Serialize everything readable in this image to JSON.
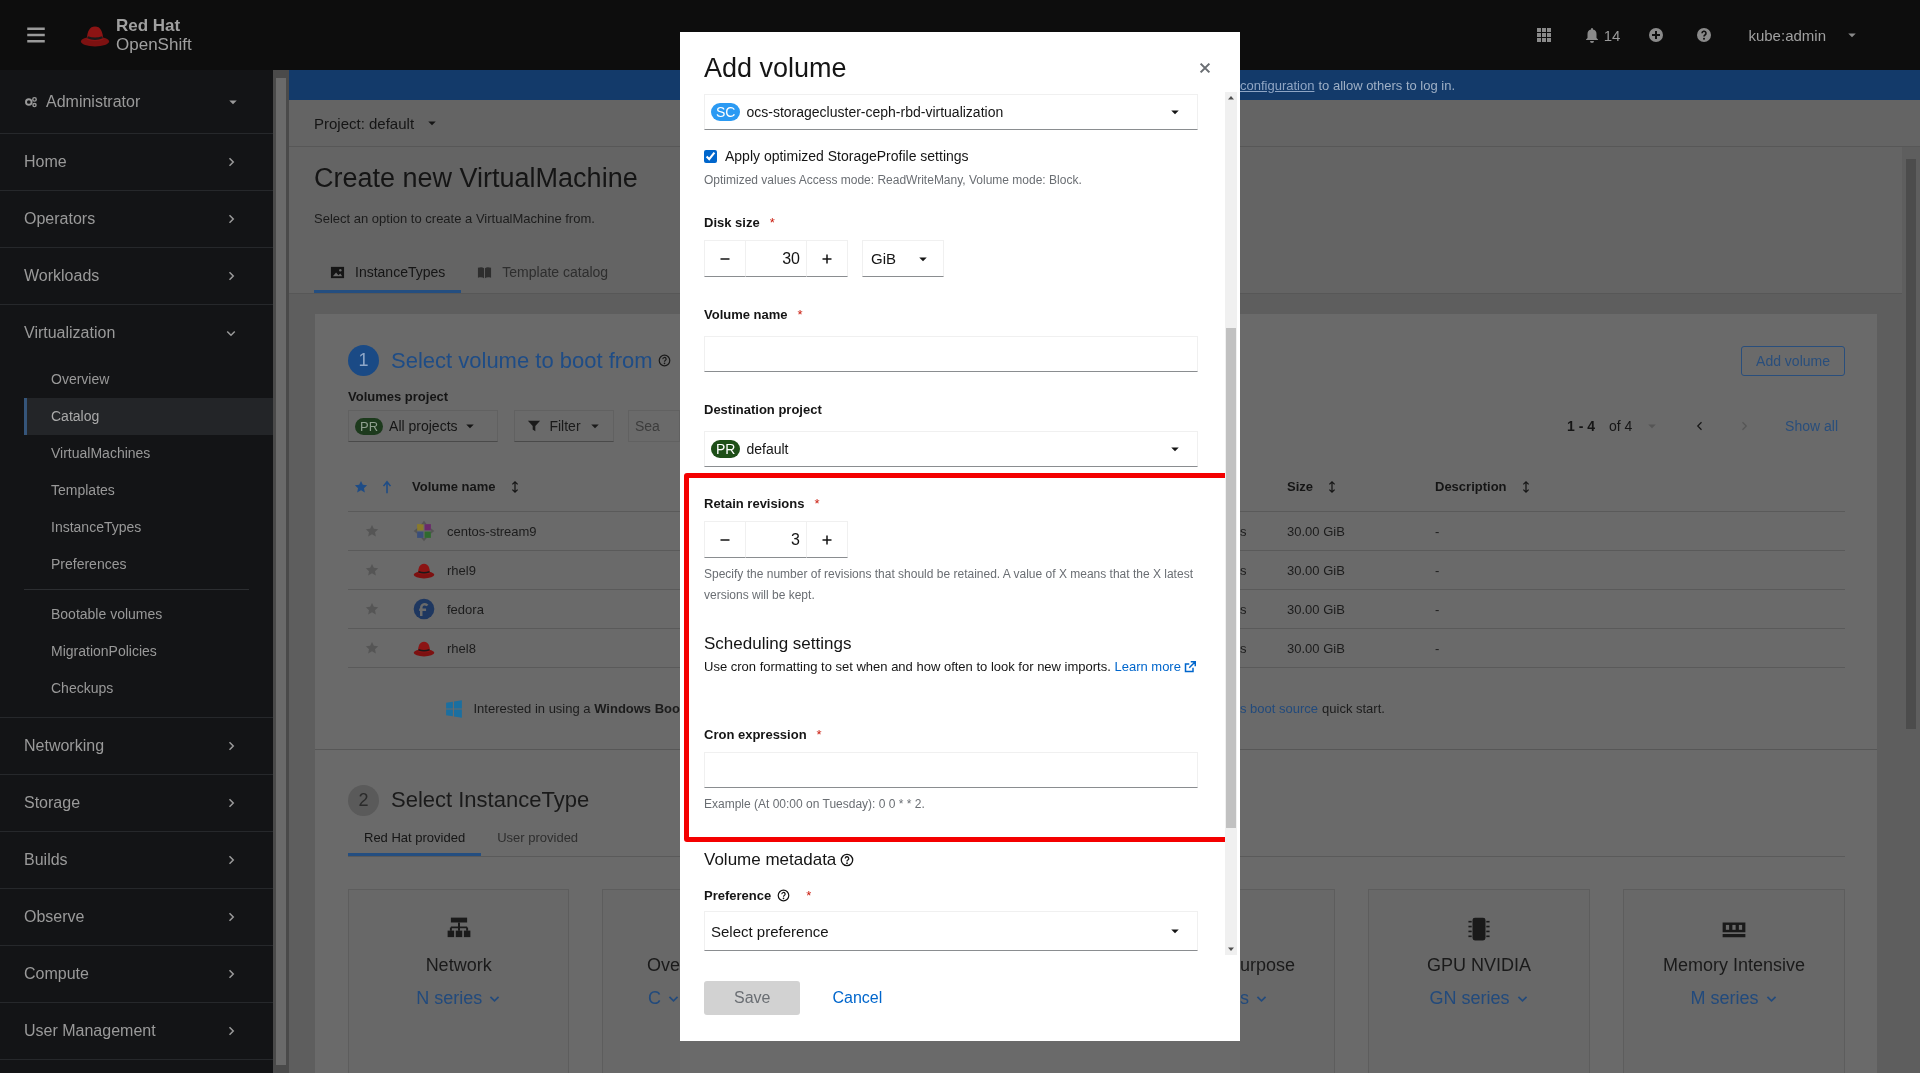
{
  "masthead": {
    "brand_top": "Red Hat",
    "brand_bottom": "OpenShift",
    "notification_count": "14",
    "user": "kube:admin"
  },
  "banner": {
    "link": "configuration",
    "text": "to allow others to log in."
  },
  "sidebar": {
    "perspective": "Administrator",
    "items": [
      {
        "label": "Home",
        "expanded": false
      },
      {
        "label": "Operators",
        "expanded": false
      },
      {
        "label": "Workloads",
        "expanded": false
      },
      {
        "label": "Virtualization",
        "expanded": true,
        "groups": [
          {
            "children": [
              {
                "label": "Overview",
                "selected": false
              },
              {
                "label": "Catalog",
                "selected": true
              },
              {
                "label": "VirtualMachines",
                "selected": false
              },
              {
                "label": "Templates",
                "selected": false
              },
              {
                "label": "InstanceTypes",
                "selected": false
              },
              {
                "label": "Preferences",
                "selected": false
              }
            ]
          },
          {
            "children": [
              {
                "label": "Bootable volumes",
                "selected": false
              },
              {
                "label": "MigrationPolicies",
                "selected": false
              },
              {
                "label": "Checkups",
                "selected": false
              }
            ]
          }
        ]
      },
      {
        "label": "Networking",
        "expanded": false
      },
      {
        "label": "Storage",
        "expanded": false
      },
      {
        "label": "Builds",
        "expanded": false
      },
      {
        "label": "Observe",
        "expanded": false
      },
      {
        "label": "Compute",
        "expanded": false
      },
      {
        "label": "User Management",
        "expanded": false
      }
    ]
  },
  "page": {
    "project_selector": "Project: default",
    "title": "Create new VirtualMachine",
    "subtitle": "Select an option to create a VirtualMachine from.",
    "tabs": [
      {
        "label": "InstanceTypes",
        "selected": true
      },
      {
        "label": "Template catalog",
        "selected": false
      }
    ]
  },
  "volume_step": {
    "number": "1",
    "title": "Select volume to boot from",
    "add_button": "Add volume",
    "project_label": "Volumes project",
    "project_filter": {
      "badge": "PR",
      "value": "All projects"
    },
    "filter_button": "Filter",
    "search_placeholder": "Sea",
    "pagination": "**1 - 4** of 4",
    "show_all": "Show all",
    "table": {
      "columns": [
        {
          "label": "Volume name"
        },
        {
          "label": "Size"
        },
        {
          "label": "Description"
        }
      ],
      "rows": [
        {
          "name": "centos-stream9",
          "column_3": "s",
          "size": "30.00 GiB",
          "description": "-"
        },
        {
          "name": "rhel9",
          "column_3": "s",
          "size": "30.00 GiB",
          "description": "-"
        },
        {
          "name": "fedora",
          "column_3": "s",
          "size": "30.00 GiB",
          "description": "-"
        },
        {
          "name": "rhel8",
          "column_3": "s",
          "size": "30.00 GiB",
          "description": "-"
        }
      ]
    },
    "windows_note": {
      "text": "Interested in using a **Windows Boo**",
      "link": "s boot source",
      "text_end": "quick start."
    }
  },
  "instancetype_step": {
    "number": "2",
    "title": "Select InstanceType",
    "tabs": [
      {
        "label": "Red Hat provided",
        "selected": true
      },
      {
        "label": "User provided",
        "selected": false
      }
    ],
    "tiles": [
      {
        "name": "Network",
        "series": "N series"
      },
      {
        "name": "Ove",
        "series": "C"
      },
      {
        "name": "urpose",
        "series": "s"
      },
      {
        "name": "GPU NVIDIA",
        "series": "GN series"
      },
      {
        "name": "Memory Intensive",
        "series": "M series"
      }
    ]
  },
  "modal": {
    "title": "Add volume",
    "storage_class": {
      "badge": "SC",
      "value": "ocs-storagecluster-ceph-rbd-virtualization"
    },
    "optimize": {
      "label": "Apply optimized StorageProfile settings",
      "checked": true,
      "help": "Optimized values Access mode: ReadWriteMany, Volume mode: Block."
    },
    "disk_size": {
      "label": "Disk size",
      "required_mark": "*",
      "value": "30",
      "unit": "GiB"
    },
    "volume_name": {
      "label": "Volume name",
      "required_mark": "*"
    },
    "destination_project": {
      "label": "Destination project",
      "badge": "PR",
      "value": "default"
    },
    "retain_revisions": {
      "label": "Retain revisions",
      "required_mark": "*",
      "value": "3",
      "help": "Specify the number of revisions that should be retained. A value of X means that the X latest versions will be kept."
    },
    "scheduling": {
      "heading": "Scheduling settings",
      "text": "Use cron formatting to set when and how often to look for new imports.",
      "link": "Learn more"
    },
    "cron_expression": {
      "label": "Cron expression",
      "required_mark": "*",
      "help": "Example (At 00:00 on Tuesday): 0 0 * * 2."
    },
    "volume_metadata": "Volume metadata",
    "preference": {
      "label": "Preference",
      "required_mark": "*",
      "placeholder": "Select preference"
    },
    "save": {
      "label": "Save",
      "disabled": true
    },
    "cancel": "Cancel"
  }
}
